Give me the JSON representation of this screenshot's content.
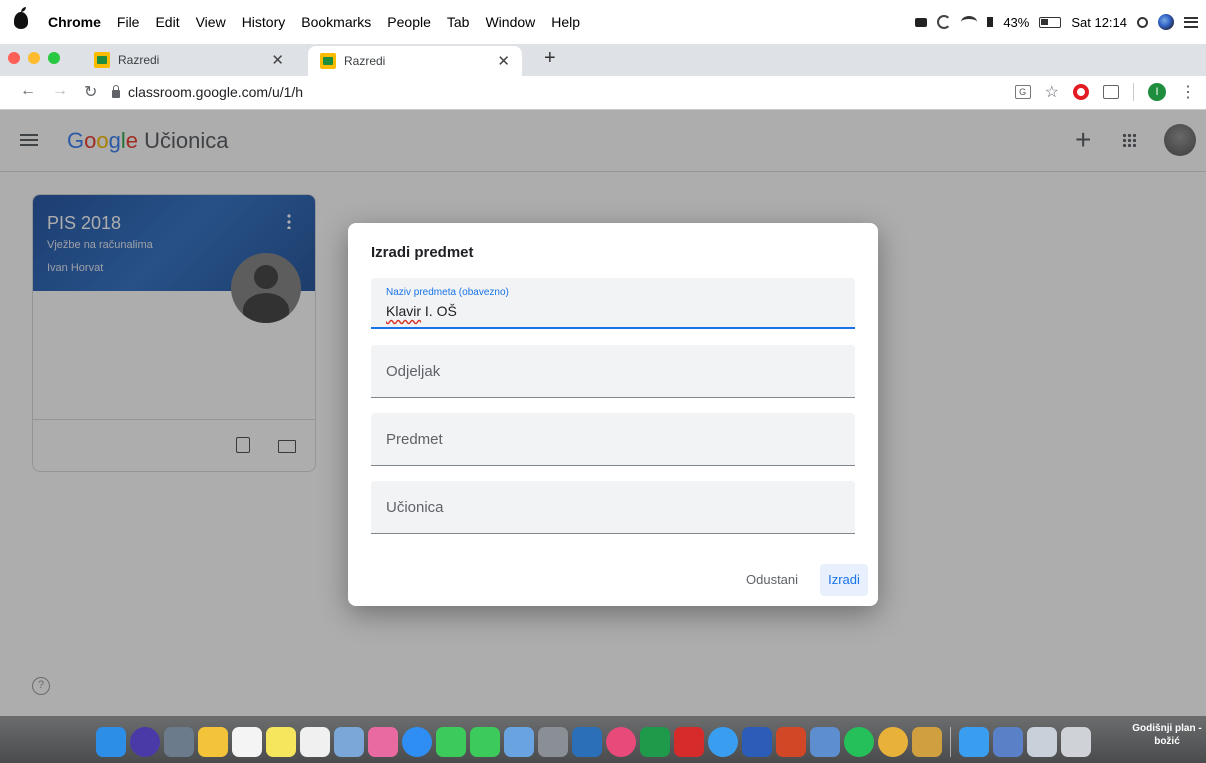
{
  "menubar": {
    "app_name": "Chrome",
    "items": [
      "File",
      "Edit",
      "View",
      "History",
      "Bookmarks",
      "People",
      "Tab",
      "Window",
      "Help"
    ],
    "battery": "43%",
    "clock": "Sat 12:14"
  },
  "tabs": [
    {
      "title": "Razredi",
      "active": false
    },
    {
      "title": "Razredi",
      "active": true
    }
  ],
  "toolbar": {
    "url": "classroom.google.com/u/1/h",
    "profile_initial": "I"
  },
  "appbar": {
    "brand_google": [
      "G",
      "o",
      "o",
      "g",
      "l",
      "e"
    ],
    "brand_product": "Učionica"
  },
  "class_card": {
    "title": "PIS 2018",
    "section": "Vježbe na računalima",
    "teacher": "Ivan Horvat"
  },
  "dialog": {
    "title": "Izradi predmet",
    "fields": {
      "name_label": "Naziv predmeta (obavezno)",
      "name_value_word1": "Klavir",
      "name_value_rest": " I. OŠ",
      "section_placeholder": "Odjeljak",
      "subject_placeholder": "Predmet",
      "room_placeholder": "Učionica"
    },
    "cancel_label": "Odustani",
    "create_label": "Izradi"
  },
  "dock": {
    "icons": [
      "finder",
      "siri",
      "launchpad",
      "notes",
      "calendar",
      "stickies",
      "reminders",
      "photos-sticker",
      "photos",
      "app-store",
      "messages",
      "facetime",
      "preview",
      "system-preferences",
      "dvd",
      "itunes",
      "excel",
      "acrobat",
      "safari",
      "word",
      "powerpoint",
      "mail",
      "whatsapp",
      "chrome",
      "keychain",
      "updates",
      "screens",
      "display",
      "trash"
    ],
    "label": "Godišnji plan - božić"
  },
  "colors": {
    "accent": "#1a73e8",
    "card_header": "#3a78c8"
  }
}
